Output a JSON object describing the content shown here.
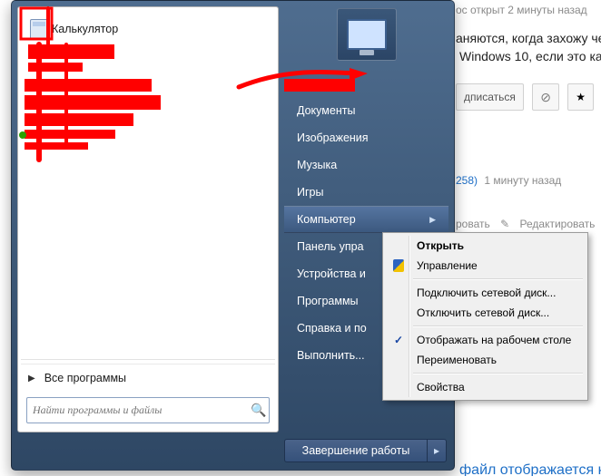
{
  "bg": {
    "time_opened": "ос открыт 2 минуты назад",
    "line1": "аняются, когда захожу че",
    "line2": "Windows 10, если это ка",
    "subscribe": "дписаться",
    "userrep": "258)",
    "ago2": "1 минуту назад",
    "edit1": "ровать",
    "edit2": "Редактировать",
    "filedisp": "файл отображается к"
  },
  "start": {
    "pinned": [
      {
        "label": "Калькулятор"
      }
    ],
    "all_programs": "Все программы",
    "search_placeholder": "Найти программы и файлы",
    "right_items": [
      "Документы",
      "Изображения",
      "Музыка",
      "Игры",
      "Компьютер",
      "Панель упра",
      "Устройства и",
      "Программы",
      "Справка и по",
      "Выполнить..."
    ],
    "shutdown": "Завершение работы"
  },
  "ctx": {
    "open": "Открыть",
    "manage": "Управление",
    "map": "Подключить сетевой диск...",
    "unmap": "Отключить сетевой диск...",
    "showdesk": "Отображать на рабочем столе",
    "rename": "Переименовать",
    "props": "Свойства"
  }
}
